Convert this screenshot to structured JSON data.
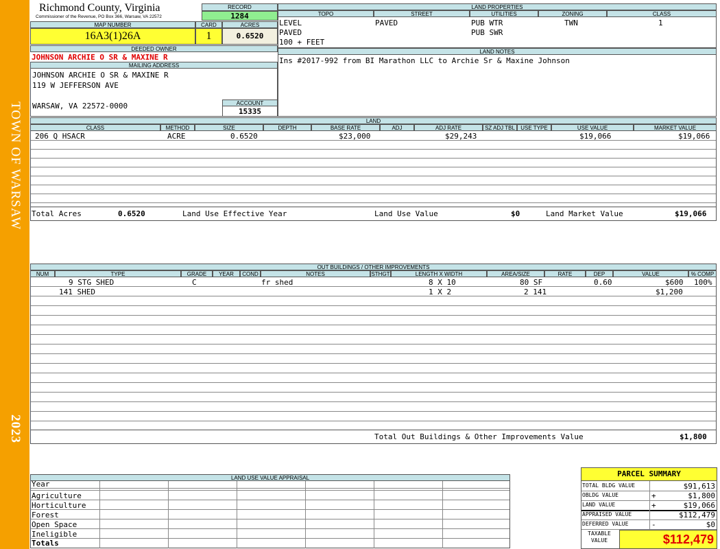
{
  "side_banner": {
    "town": "TOWN OF WARSAW",
    "year": "2023",
    "color": "#f5a000"
  },
  "county": {
    "title": "Richmond County, Virginia",
    "subtitle": "Commissioner of the Revenue, PO Box 366, Warsaw, VA 22572"
  },
  "record": {
    "label": "RECORD",
    "value": "1284"
  },
  "map_number": {
    "label": "MAP NUMBER",
    "value": "16A3(1)26A"
  },
  "card": {
    "label": "CARD",
    "value": "1"
  },
  "acres": {
    "label": "ACRES",
    "value": "0.6520"
  },
  "deeded_owner": {
    "label": "DEEDED OWNER",
    "value": "JOHNSON ARCHIE O SR & MAXINE R"
  },
  "mailing": {
    "label": "MAILING ADDRESS",
    "line1": "JOHNSON ARCHIE O SR & MAXINE R",
    "line2": "119 W JEFFERSON AVE",
    "line3": "WARSAW, VA 22572-0000"
  },
  "account": {
    "label": "ACCOUNT",
    "value": "15335"
  },
  "land_properties": {
    "label": "LAND PROPERTIES",
    "headers": [
      "TOPO",
      "STREET",
      "UTILITIES",
      "ZONING",
      "CLASS"
    ],
    "topo": [
      "LEVEL",
      "PAVED",
      "100 + FEET"
    ],
    "street": "PAVED",
    "utilities": [
      "PUB WTR",
      "PUB SWR"
    ],
    "zoning": "TWN",
    "class": "1"
  },
  "land_notes": {
    "label": "LAND NOTES",
    "text": "Ins #2017-992 from BI Marathon LLC to Archie Sr & Maxine Johnson"
  },
  "land": {
    "label": "LAND",
    "headers": [
      "CLASS",
      "METHOD",
      "SIZE",
      "DEPTH",
      "BASE RATE",
      "ADJ",
      "ADJ RATE",
      "SZ ADJ TBL",
      "USE TYPE",
      "USE VALUE",
      "MARKET VALUE"
    ],
    "row": {
      "class": "206 Q HSACR",
      "method": "ACRE",
      "size": "0.6520",
      "base_rate": "$23,000",
      "adj_rate": "$29,243",
      "use_value": "$19,066",
      "market_value": "$19,066"
    },
    "totals": {
      "total_acres_label": "Total Acres",
      "total_acres": "0.6520",
      "effective_year_label": "Land Use Effective Year",
      "use_value_label": "Land Use Value",
      "use_value": "$0",
      "market_value_label": "Land Market Value",
      "market_value": "$19,066"
    }
  },
  "outbuildings": {
    "label": "OUT BUILDINGS / OTHER IMPROVEMENTS",
    "headers": [
      "NUM",
      "TYPE",
      "GRADE",
      "YEAR",
      "COND",
      "NOTES",
      "STHGT",
      "LENGTH X WIDTH",
      "AREA/SIZE",
      "RATE",
      "DEP",
      "VALUE",
      "% COMP"
    ],
    "rows": [
      {
        "type": "9 STG SHED",
        "grade": "C",
        "notes": "fr shed",
        "dims": "8 X 10",
        "area": "80 SF",
        "dep": "0.60",
        "value": "$600",
        "comp": "100%"
      },
      {
        "type": "141 SHED",
        "grade": "",
        "notes": "",
        "dims": "1 X 2",
        "area": "2 141",
        "dep": "",
        "value": "$1,200",
        "comp": ""
      }
    ],
    "total_label": "Total Out Buildings & Other Improvements Value",
    "total": "$1,800"
  },
  "land_use_appraisal": {
    "label": "LAND USE VALUE APPRAISAL",
    "rows": [
      "Year",
      "Agriculture",
      "Horticulture",
      "Forest",
      "Open Space",
      "Ineligible",
      "Totals"
    ]
  },
  "parcel_summary": {
    "title": "PARCEL SUMMARY",
    "rows": [
      {
        "label": "TOTAL BLDG VALUE",
        "sign": "",
        "value": "$91,613"
      },
      {
        "label": "OBLDG VALUE",
        "sign": "+",
        "value": "$1,800"
      },
      {
        "label": "LAND VALUE",
        "sign": "+",
        "value": "$19,066"
      },
      {
        "label": "APPRAISED VALUE",
        "sign": "",
        "value": "$112,479"
      },
      {
        "label": "DEFERRED VALUE",
        "sign": "-",
        "value": "$0"
      }
    ],
    "taxable_label": "TAXABLE VALUE",
    "taxable_value": "$112,479"
  }
}
